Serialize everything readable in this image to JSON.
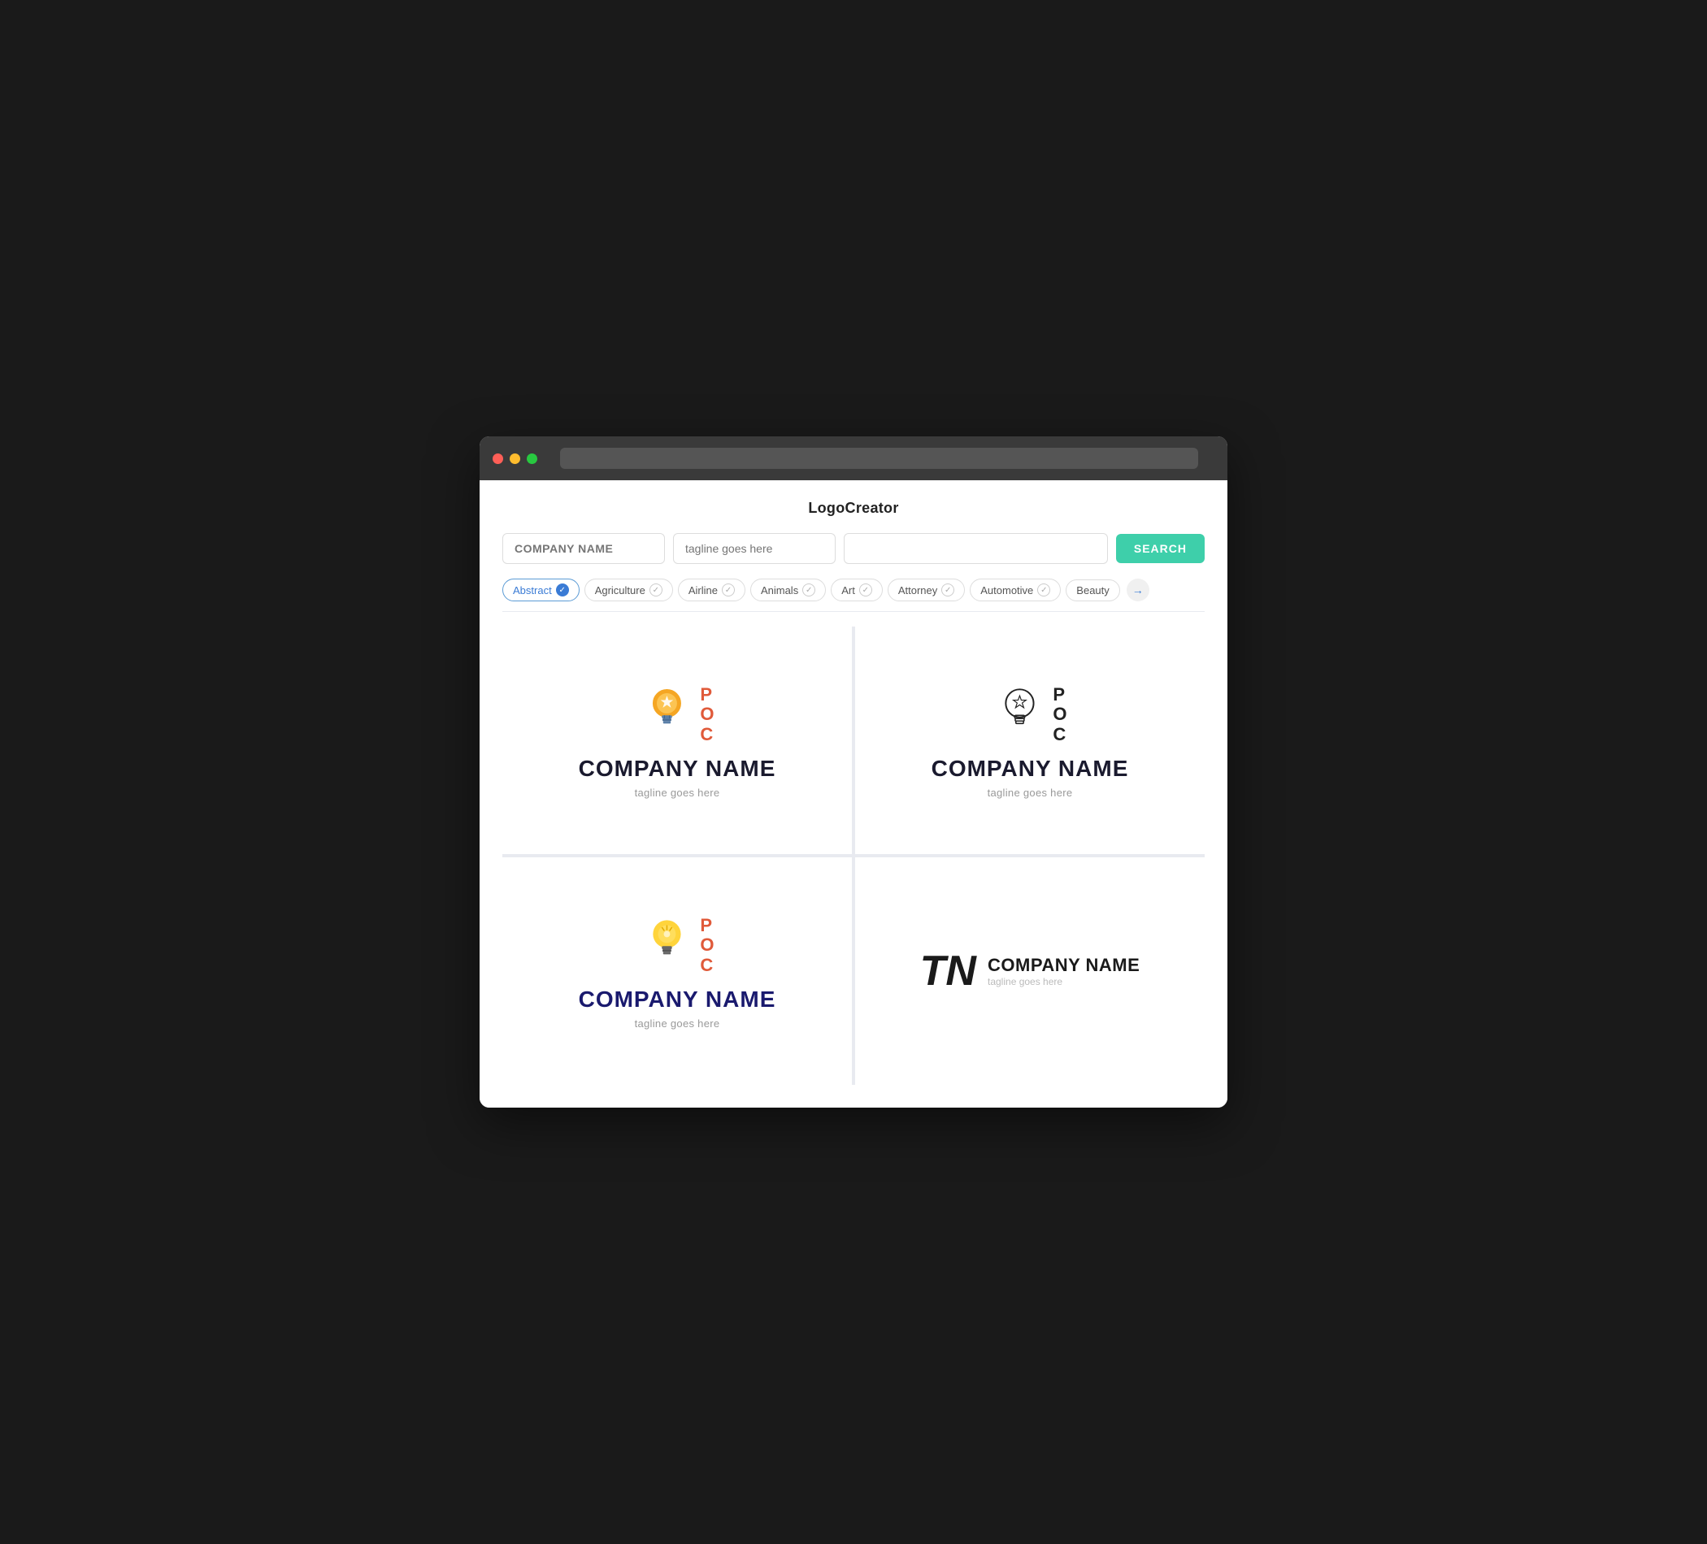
{
  "app": {
    "title": "LogoCreator",
    "address_bar_placeholder": ""
  },
  "search": {
    "company_placeholder": "COMPANY NAME",
    "tagline_placeholder": "tagline goes here",
    "industry_placeholder": "",
    "button_label": "SEARCH"
  },
  "filters": [
    {
      "id": "abstract",
      "label": "Abstract",
      "active": true
    },
    {
      "id": "agriculture",
      "label": "Agriculture",
      "active": false
    },
    {
      "id": "airline",
      "label": "Airline",
      "active": false
    },
    {
      "id": "animals",
      "label": "Animals",
      "active": false
    },
    {
      "id": "art",
      "label": "Art",
      "active": false
    },
    {
      "id": "attorney",
      "label": "Attorney",
      "active": false
    },
    {
      "id": "automotive",
      "label": "Automotive",
      "active": false
    },
    {
      "id": "beauty",
      "label": "Beauty",
      "active": false
    }
  ],
  "logos": [
    {
      "id": "logo1",
      "type": "colored-bulb",
      "poc": [
        "P",
        "O",
        "C"
      ],
      "company_name": "COMPANY NAME",
      "tagline": "tagline goes here"
    },
    {
      "id": "logo2",
      "type": "outline-bulb",
      "poc": [
        "P",
        "O",
        "C"
      ],
      "company_name": "COMPANY NAME",
      "tagline": "tagline goes here"
    },
    {
      "id": "logo3",
      "type": "yellow-bulb",
      "poc": [
        "P",
        "O",
        "C"
      ],
      "company_name": "COMPANY NAME",
      "tagline": "tagline goes here"
    },
    {
      "id": "logo4",
      "type": "tn-monogram",
      "monogram": "TN",
      "company_name": "COMPANY NAME",
      "tagline": "tagline goes here"
    }
  ],
  "colors": {
    "search_button": "#3ecfaa",
    "active_filter": "#3a7bd5",
    "poc_color": "#e05a3a",
    "navy": "#1a1a6e"
  }
}
